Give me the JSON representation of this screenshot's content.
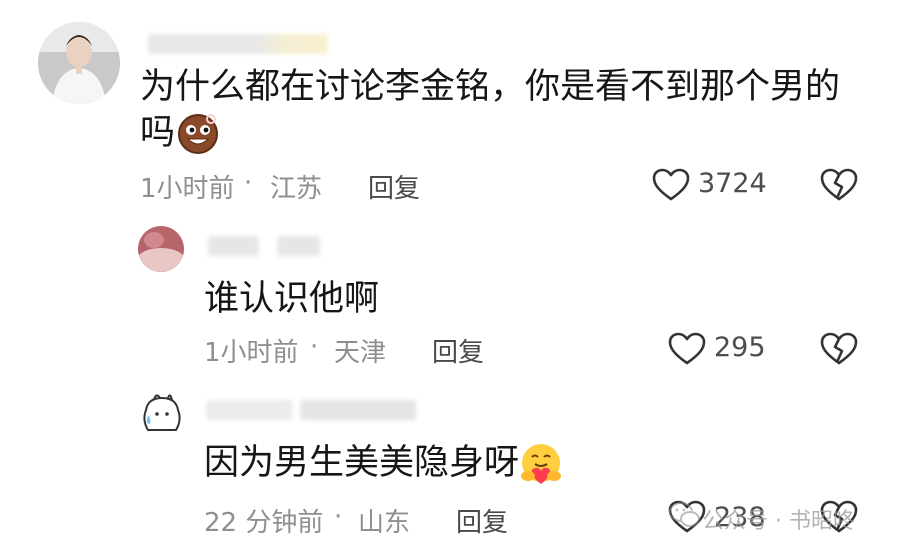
{
  "comments": [
    {
      "text_line1": "为什么都在讨论李金铭，你是看不到那个男的",
      "text_line2": "吗",
      "emoji": "laughing-cookie-emoji",
      "time": "1小时前",
      "separator": "·",
      "location": "江苏",
      "reply_label": "回复",
      "likes": "3724"
    },
    {
      "text": "谁认识他啊",
      "time": "1小时前",
      "separator": "·",
      "location": "天津",
      "reply_label": "回复",
      "likes": "295"
    },
    {
      "text": "因为男生美美隐身呀",
      "emoji": "hugging-face-emoji",
      "time": "22 分钟前",
      "separator": "·",
      "location": "山东",
      "reply_label": "回复",
      "likes": "238"
    }
  ],
  "watermark": {
    "icon": "wechat-icon",
    "text": "公众号 · 书昭咚"
  },
  "colors": {
    "text": "#161616",
    "meta": "#8f8f8f",
    "icon": "#333333"
  }
}
